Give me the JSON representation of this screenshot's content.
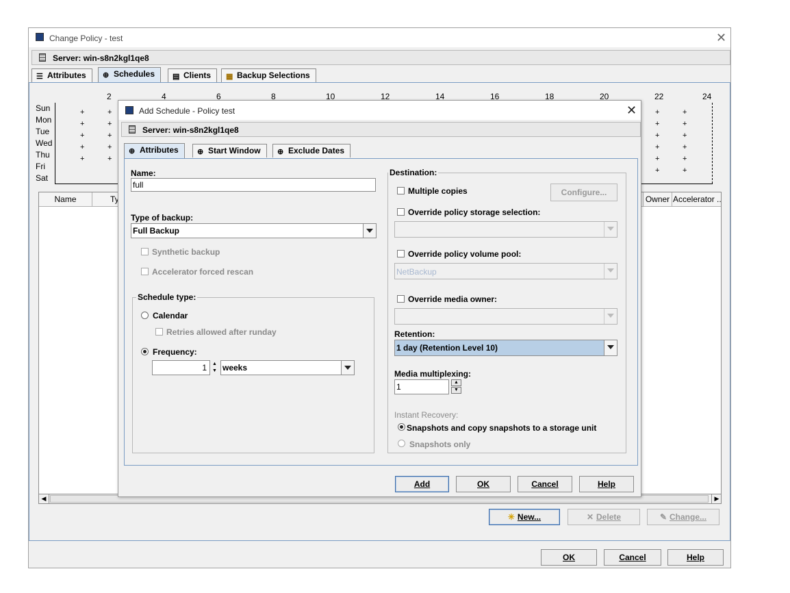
{
  "outer_window": {
    "title": "Change Policy - test",
    "server_label": "Server: win-s8n2kgl1qe8",
    "tabs": [
      {
        "label": "Attributes",
        "icon": "attributes-icon"
      },
      {
        "label": "Schedules",
        "icon": "schedules-icon"
      },
      {
        "label": "Clients",
        "icon": "clients-icon"
      },
      {
        "label": "Backup Selections",
        "icon": "backup-selections-icon"
      }
    ],
    "selected_tab": "Schedules",
    "schedule_grid": {
      "hour_ticks": [
        "2",
        "4",
        "6",
        "8",
        "10",
        "12",
        "14",
        "16",
        "18",
        "20",
        "22",
        "24"
      ],
      "days": [
        "Sun",
        "Mon",
        "Tue",
        "Wed",
        "Thu",
        "Fri",
        "Sat"
      ]
    },
    "table_columns": [
      "Name",
      "Ty",
      "Owner",
      "Accelerator ..."
    ],
    "buttons": {
      "new": "New...",
      "delete": "Delete",
      "change": "Change..."
    },
    "footer_buttons": {
      "ok": "OK",
      "cancel": "Cancel",
      "help": "Help"
    }
  },
  "dialog": {
    "title": "Add Schedule - Policy test",
    "server_label": "Server: win-s8n2kgl1qe8",
    "tabs": [
      {
        "label": "Attributes",
        "icon": "attributes-icon"
      },
      {
        "label": "Start Window",
        "icon": "start-window-icon"
      },
      {
        "label": "Exclude Dates",
        "icon": "exclude-dates-icon"
      }
    ],
    "selected_tab": "Attributes",
    "left": {
      "name_label": "Name:",
      "name_value": "full",
      "type_label": "Type of backup:",
      "type_value": "Full Backup",
      "synthetic_label": "Synthetic backup",
      "accelerator_label": "Accelerator forced rescan",
      "schedule_type_legend": "Schedule type:",
      "calendar_label": "Calendar",
      "retries_label": "Retries allowed after runday",
      "frequency_label": "Frequency:",
      "frequency_value": "1",
      "frequency_unit": "weeks"
    },
    "right": {
      "destination_legend": "Destination:",
      "multiple_copies_label": "Multiple copies",
      "configure_button": "Configure...",
      "override_storage_label": "Override policy storage selection:",
      "override_volume_label": "Override policy volume pool:",
      "volume_pool_value": "NetBackup",
      "override_owner_label": "Override media owner:",
      "retention_label": "Retention:",
      "retention_value": "1 day (Retention Level 10)",
      "multiplexing_label": "Media multiplexing:",
      "multiplexing_value": "1",
      "instant_recovery_label": "Instant Recovery:",
      "snapshots_copy_label": "Snapshots and copy snapshots to a storage unit",
      "snapshots_only_label": "Snapshots only"
    },
    "buttons": {
      "add": "Add",
      "ok": "OK",
      "cancel": "Cancel",
      "help": "Help"
    }
  }
}
